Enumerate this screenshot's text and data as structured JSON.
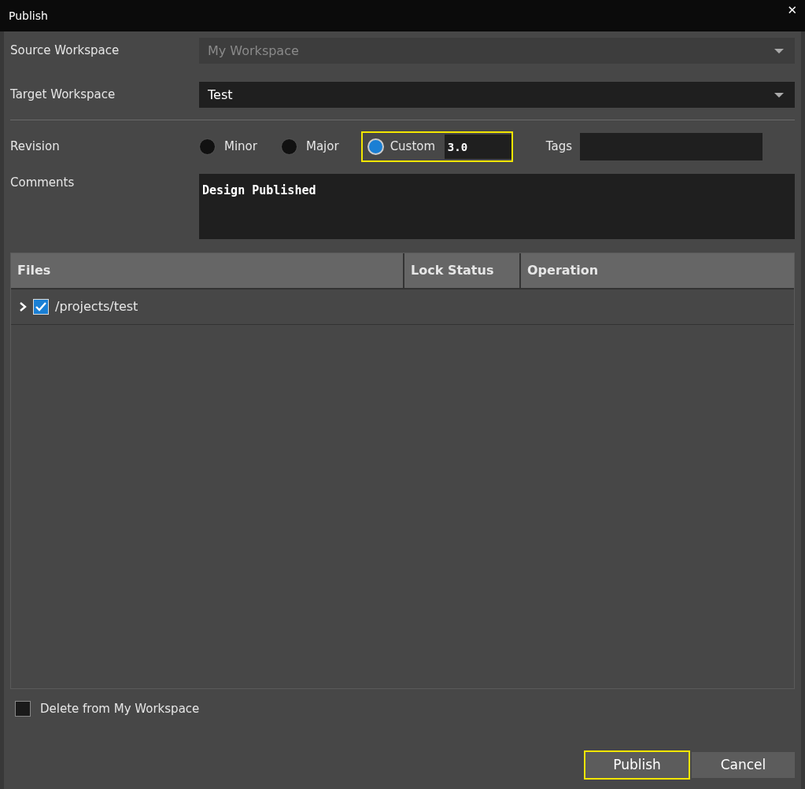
{
  "window": {
    "title": "Publish",
    "close": "✕"
  },
  "source_workspace": {
    "label": "Source Workspace",
    "value": "My Workspace",
    "disabled": true
  },
  "target_workspace": {
    "label": "Target Workspace",
    "value": "Test",
    "disabled": false
  },
  "revision": {
    "label": "Revision",
    "options": [
      {
        "label": "Minor",
        "selected": false,
        "highlighted": false
      },
      {
        "label": "Major",
        "selected": false,
        "highlighted": false
      },
      {
        "label": "Custom",
        "selected": true,
        "highlighted": true,
        "value": "3.0"
      }
    ],
    "tags_label": "Tags"
  },
  "comments": {
    "label": "Comments",
    "value": "Design Published"
  },
  "table": {
    "columns": [
      "Files",
      "Lock Status",
      "Operation"
    ],
    "rows": [
      {
        "path": "/projects/test",
        "checked": true,
        "expanded": false
      }
    ]
  },
  "delete_option": {
    "label": "Delete from My Workspace",
    "checked": false
  },
  "buttons": [
    {
      "label": "Publish",
      "highlighted": true
    },
    {
      "label": "Cancel",
      "highlighted": false
    }
  ]
}
